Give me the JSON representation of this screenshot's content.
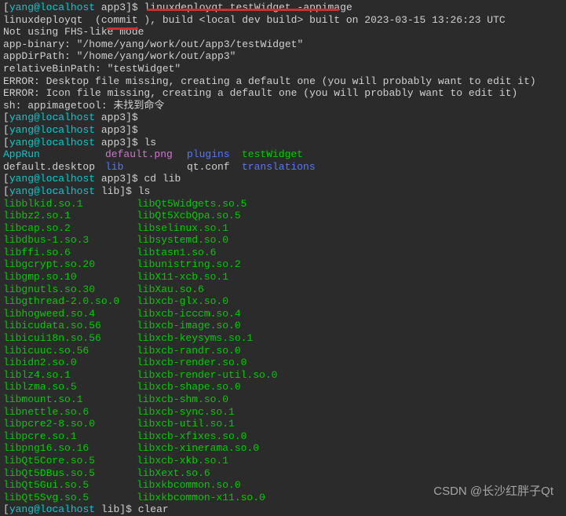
{
  "prompts": {
    "user": "yang",
    "host": "localhost",
    "dir_app3": "app3",
    "dir_lib": "lib"
  },
  "commands": {
    "cmd1": "linuxdeployqt testWidget -appimage",
    "cmd2": "",
    "cmd3": "",
    "cmd4": "ls",
    "cmd5": "cd lib",
    "cmd6": "ls",
    "cmd7": "clear"
  },
  "output": {
    "l1": "linuxdeployqt  (commit ), build <local dev build> built on 2023-03-15 13:26:23 UTC",
    "l2": "Not using FHS-like mode",
    "l3": "app-binary: \"/home/yang/work/out/app3/testWidget\"",
    "l4": "appDirPath: \"/home/yang/work/out/app3\"",
    "l5": "relativeBinPath: \"testWidget\"",
    "l6": "ERROR: Desktop file missing, creating a default one (you will probably want to edit it)",
    "l7": "ERROR: Icon file missing, creating a default one (you will probably want to edit it)",
    "l8": "sh: appimagetool: 未找到命令"
  },
  "ls_app3": {
    "r1c1": "AppRun",
    "r1c2": "default.png",
    "r1c3": "plugins",
    "r1c4": "testWidget",
    "r2c1": "default.desktop",
    "r2c2": "lib",
    "r2c3": "qt.conf",
    "r2c4": "translations"
  },
  "ls_lib": [
    {
      "a": "libblkid.so.1",
      "b": "libQt5Widgets.so.5"
    },
    {
      "a": "libbz2.so.1",
      "b": "libQt5XcbQpa.so.5"
    },
    {
      "a": "libcap.so.2",
      "b": "libselinux.so.1"
    },
    {
      "a": "libdbus-1.so.3",
      "b": "libsystemd.so.0"
    },
    {
      "a": "libffi.so.6",
      "b": "libtasn1.so.6"
    },
    {
      "a": "libgcrypt.so.20",
      "b": "libunistring.so.2"
    },
    {
      "a": "libgmp.so.10",
      "b": "libX11-xcb.so.1"
    },
    {
      "a": "libgnutls.so.30",
      "b": "libXau.so.6"
    },
    {
      "a": "libgthread-2.0.so.0",
      "b": "libxcb-glx.so.0"
    },
    {
      "a": "libhogweed.so.4",
      "b": "libxcb-icccm.so.4"
    },
    {
      "a": "libicudata.so.56",
      "b": "libxcb-image.so.0"
    },
    {
      "a": "libicui18n.so.56",
      "b": "libxcb-keysyms.so.1"
    },
    {
      "a": "libicuuc.so.56",
      "b": "libxcb-randr.so.0"
    },
    {
      "a": "libidn2.so.0",
      "b": "libxcb-render.so.0"
    },
    {
      "a": "liblz4.so.1",
      "b": "libxcb-render-util.so.0"
    },
    {
      "a": "liblzma.so.5",
      "b": "libxcb-shape.so.0"
    },
    {
      "a": "libmount.so.1",
      "b": "libxcb-shm.so.0"
    },
    {
      "a": "libnettle.so.6",
      "b": "libxcb-sync.so.1"
    },
    {
      "a": "libpcre2-8.so.0",
      "b": "libxcb-util.so.1"
    },
    {
      "a": "libpcre.so.1",
      "b": "libxcb-xfixes.so.0"
    },
    {
      "a": "libpng16.so.16",
      "b": "libxcb-xinerama.so.0"
    },
    {
      "a": "libQt5Core.so.5",
      "b": "libxcb-xkb.so.1"
    },
    {
      "a": "libQt5DBus.so.5",
      "b": "libXext.so.6"
    },
    {
      "a": "libQt5Gui.so.5",
      "b": "libxkbcommon.so.0"
    },
    {
      "a": "libQt5Svg.so.5",
      "b": "libxkbcommon-x11.so.0"
    }
  ],
  "watermark": "CSDN @长沙红胖子Qt"
}
